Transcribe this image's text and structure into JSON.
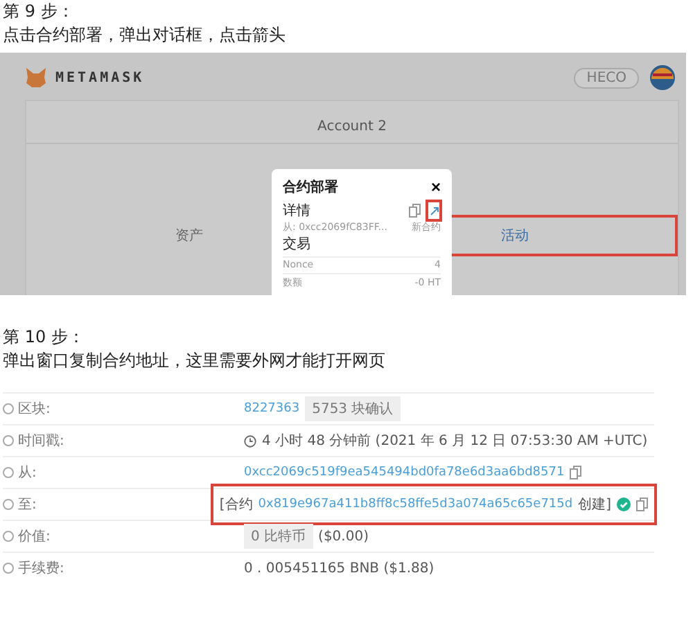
{
  "step9": {
    "title": "第 9 步：",
    "text": "点击合约部署，弹出对话框，点击箭头"
  },
  "metamask": {
    "brand": "METAMASK",
    "network": "HECO",
    "account": "Account 2",
    "tabs": [
      {
        "label": "资产",
        "selected": false,
        "highlighted": false
      },
      {
        "label": "活动",
        "selected": true,
        "highlighted": true
      }
    ],
    "modal": {
      "title": "合约部署",
      "close": "×",
      "details": "详情",
      "actions": [
        {
          "kind": "copy",
          "highlighted": false
        },
        {
          "kind": "expand",
          "highlighted": true
        }
      ],
      "from": "从: 0xcc2069fC83FF...",
      "to": "新合约",
      "section": "交易",
      "rows": [
        {
          "label": "Nonce",
          "value": "4"
        },
        {
          "label": "数额",
          "value": "-0 HT"
        }
      ]
    }
  },
  "step10": {
    "title": "第 10 步：",
    "text": "弹出窗口复制合约地址，这里需要外网才能打开网页"
  },
  "explorer": {
    "rows": [
      {
        "label": "区块:",
        "highlighted": false,
        "parts": [
          {
            "kind": "link",
            "text": "8227363"
          },
          {
            "kind": "badge",
            "text": "5753 块确认"
          }
        ]
      },
      {
        "label": "时间戳:",
        "highlighted": false,
        "parts": [
          {
            "kind": "clock"
          },
          {
            "kind": "text",
            "text": "4 小时 48 分钟前 (2021 年 6 月 12 日 07:53:30 AM +UTC)"
          }
        ]
      },
      {
        "label": "从:",
        "highlighted": false,
        "parts": [
          {
            "kind": "link",
            "text": "0xcc2069c519f9ea545494bd0fa78e6d3aa6bd8571"
          },
          {
            "kind": "copy"
          }
        ]
      },
      {
        "label": "至:",
        "highlighted": true,
        "parts": [
          {
            "kind": "text",
            "text": "[合约"
          },
          {
            "kind": "link",
            "text": "0x819e967a411b8ff8c58ffe5d3a074a65c65e715d"
          },
          {
            "kind": "text",
            "text": "创建]"
          },
          {
            "kind": "check"
          },
          {
            "kind": "copy"
          }
        ]
      },
      {
        "label": "价值:",
        "highlighted": false,
        "parts": [
          {
            "kind": "badge",
            "text": "0 比特币"
          },
          {
            "kind": "text",
            "text": "($0.00)"
          }
        ]
      },
      {
        "label": "手续费:",
        "highlighted": false,
        "parts": [
          {
            "kind": "text",
            "text": "0 . 005451165 BNB ($1.88)"
          }
        ]
      }
    ]
  }
}
